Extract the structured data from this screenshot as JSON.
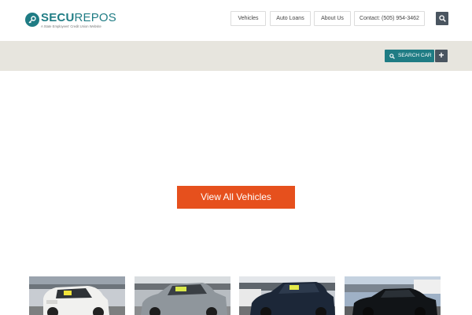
{
  "brand": {
    "name_bold": "SECU",
    "name_light": "REPOS",
    "tagline": "A State Employees' Credit Union Website",
    "accent_color": "#1f7c84"
  },
  "nav": {
    "items": [
      {
        "label": "Vehicles"
      },
      {
        "label": "Auto Loans"
      },
      {
        "label": "About Us"
      },
      {
        "label": "Contact: (505) 954-3462"
      }
    ],
    "search_icon": "search-icon"
  },
  "toolbar": {
    "search_car_label": "SEARCH CAR",
    "plus_label": "+"
  },
  "main": {
    "cta_label": "View All Vehicles",
    "cta_color": "#e6501d"
  },
  "listings": [
    {
      "name": "white-suv"
    },
    {
      "name": "silver-sedan"
    },
    {
      "name": "dark-blue-sedan"
    },
    {
      "name": "black-coupe"
    }
  ]
}
